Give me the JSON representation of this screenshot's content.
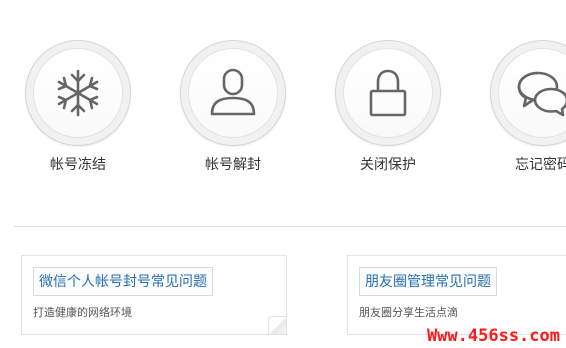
{
  "services": [
    {
      "label": "帐号冻结",
      "icon": "snowflake-icon"
    },
    {
      "label": "帐号解封",
      "icon": "person-icon"
    },
    {
      "label": "关闭保护",
      "icon": "lock-icon"
    },
    {
      "label": "忘记密码",
      "icon": "chat-bubbles-icon"
    }
  ],
  "faq_cards": [
    {
      "title": "微信个人帐号封号常见问题",
      "description": "打造健康的网络环境"
    },
    {
      "title": "朋友圈管理常见问题",
      "description": "朋友圈分享生活点滴"
    }
  ],
  "watermark": "Www.456ss.com",
  "colors": {
    "link_blue": "#2a6fb0",
    "icon_gray": "#666666",
    "watermark_red": "#ff1a1a"
  }
}
